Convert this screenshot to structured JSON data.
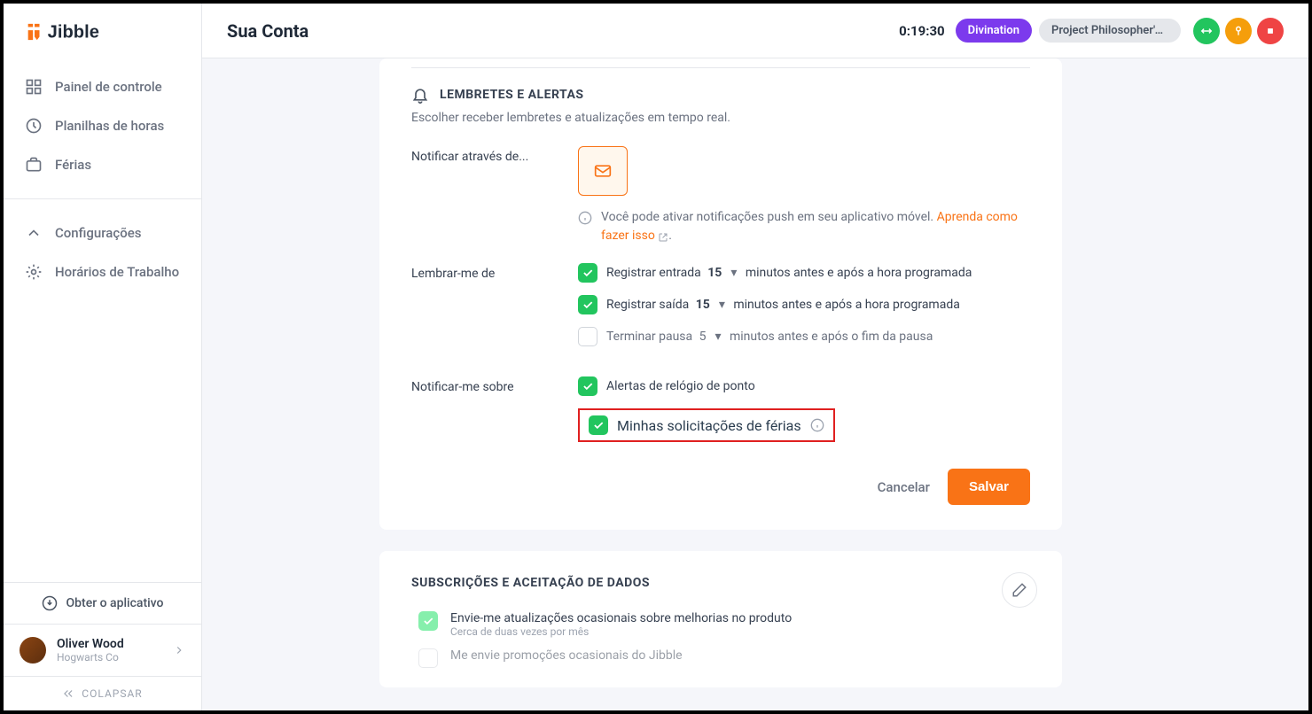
{
  "brand": "Jibble",
  "header": {
    "page_title": "Sua Conta",
    "timer": "0:19:30",
    "chip1": "Divination",
    "chip2": "Project Philosopher's S..."
  },
  "sidebar": {
    "items": {
      "dashboard": "Painel de controle",
      "timesheets": "Planilhas de horas",
      "leave": "Férias",
      "settings": "Configurações",
      "work_schedules": "Horários de Trabalho"
    },
    "get_app": "Obter o aplicativo",
    "user_name": "Oliver Wood",
    "user_org": "Hogwarts Co",
    "collapse": "COLAPSAR"
  },
  "reminders": {
    "title": "LEMBRETES E ALERTAS",
    "desc": "Escolher receber lembretes e atualizações em tempo real.",
    "notify_via": "Notificar através de...",
    "push_info_pre": "Você pode ativar notificações push em seu aplicativo móvel. ",
    "push_info_link": "Aprenda como fazer isso",
    "remind_me": "Lembrar-me de",
    "clock_in_pre": "Registrar entrada",
    "clock_in_val": "15",
    "clock_in_post": "minutos antes e após a hora programada",
    "clock_out_pre": "Registrar saída",
    "clock_out_val": "15",
    "clock_out_post": "minutos antes e após a hora programada",
    "break_pre": "Terminar pausa",
    "break_val": "5",
    "break_post": "minutos antes e após o fim da pausa",
    "notify_about": "Notificar-me sobre",
    "clock_alerts": "Alertas de relógio de ponto",
    "leave_requests": "Minhas solicitações de férias",
    "cancel": "Cancelar",
    "save": "Salvar"
  },
  "subscriptions": {
    "title": "SUBSCRIÇÕES E ACEITAÇÃO DE DADOS",
    "row1": "Envie-me atualizações ocasionais sobre melhorias no produto",
    "row1_desc": "Cerca de duas vezes por mês",
    "row2": "Me envie promoções ocasionais do Jibble"
  }
}
